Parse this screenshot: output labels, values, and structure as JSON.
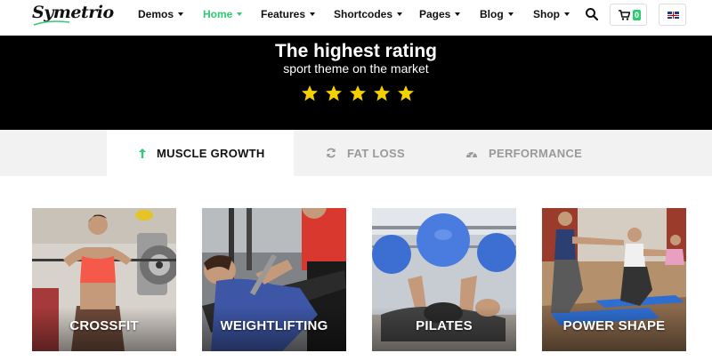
{
  "header": {
    "logo": "Symetrio",
    "nav": [
      {
        "label": "Demos",
        "active": false
      },
      {
        "label": "Home",
        "active": true
      },
      {
        "label": "Features",
        "active": false
      },
      {
        "label": "Shortcodes",
        "active": false
      },
      {
        "label": "Pages",
        "active": false
      },
      {
        "label": "Blog",
        "active": false
      },
      {
        "label": "Shop",
        "active": false
      }
    ],
    "cart_count": "0",
    "language_icon": "uk-flag-icon"
  },
  "banner": {
    "title": "The highest rating",
    "subtitle": "sport theme on the market",
    "rating": 5
  },
  "tabs": [
    {
      "label": "MUSCLE GROWTH",
      "icon": "arrow-up-icon",
      "active": true
    },
    {
      "label": "FAT LOSS",
      "icon": "refresh-icon",
      "active": false
    },
    {
      "label": "PERFORMANCE",
      "icon": "dashboard-icon",
      "active": false
    }
  ],
  "cards": [
    {
      "label": "CROSSFIT"
    },
    {
      "label": "WEIGHTLIFTING"
    },
    {
      "label": "PILATES"
    },
    {
      "label": "POWER SHAPE"
    }
  ],
  "colors": {
    "accent": "#2ecc71",
    "banner_bg": "#000000",
    "star": "#f5d000",
    "tabs_bg": "#f2f2f2"
  }
}
